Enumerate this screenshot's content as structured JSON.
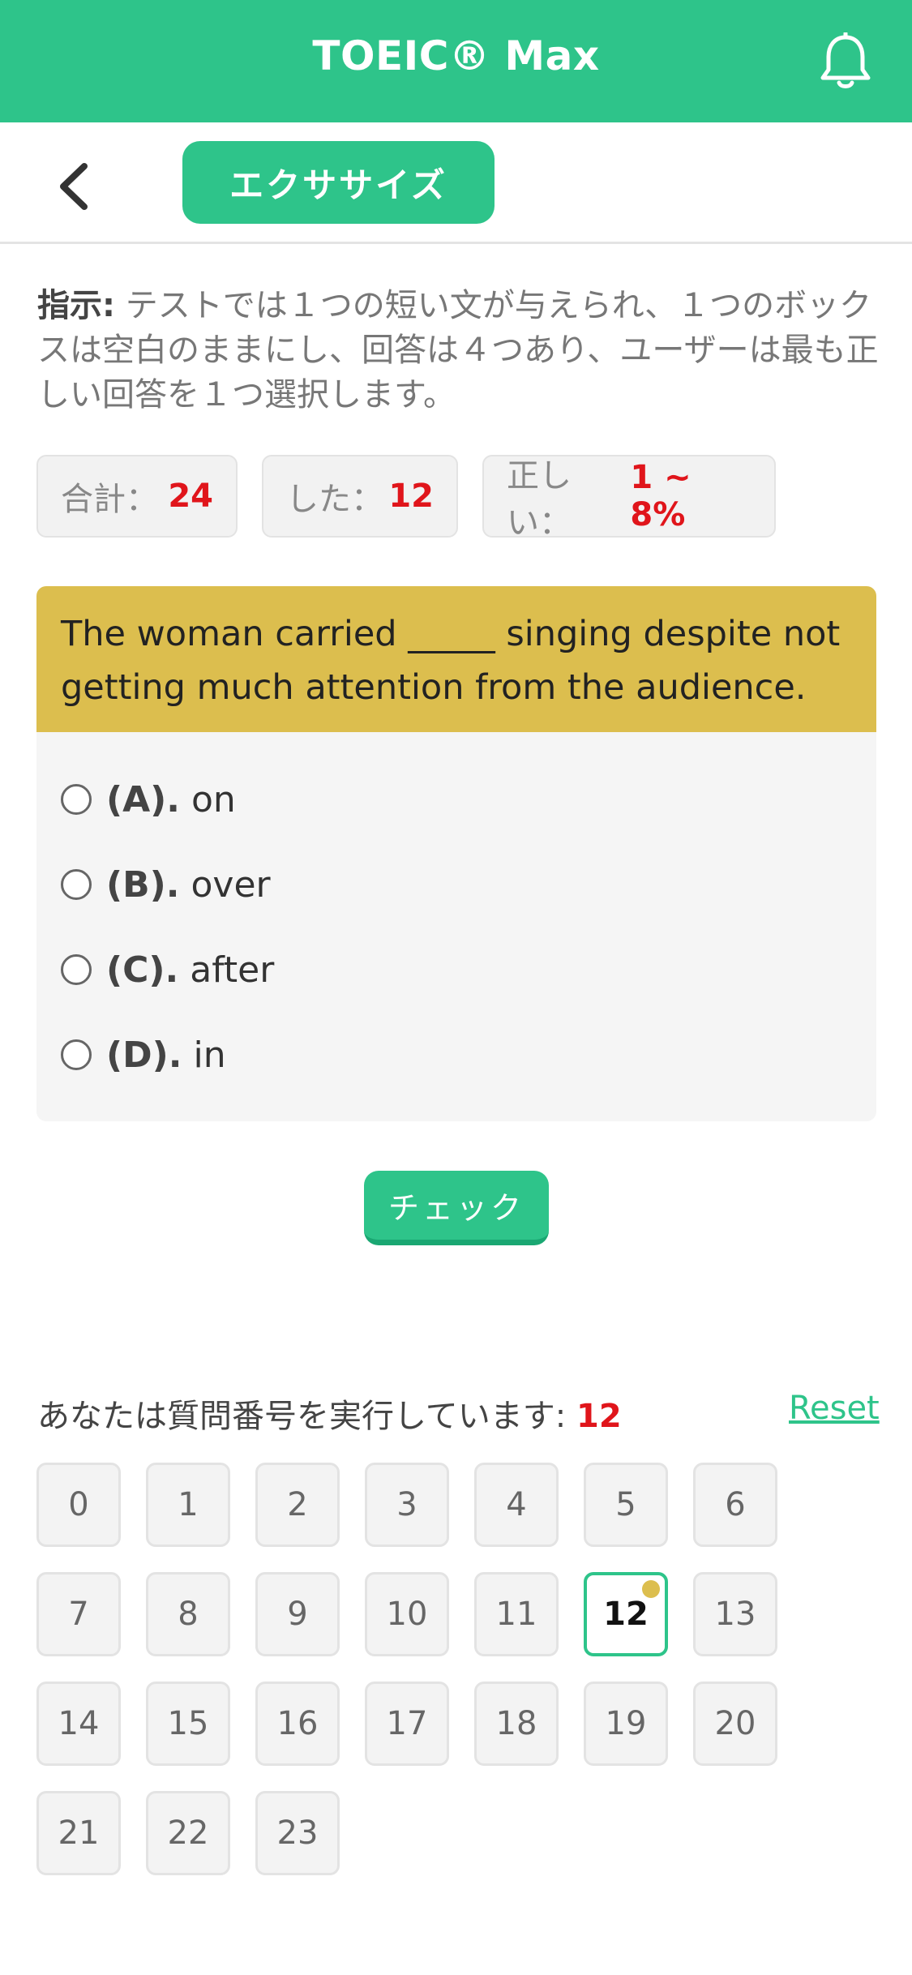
{
  "header": {
    "title": "TOEIC® Max",
    "bell_icon": "bell-icon"
  },
  "subheader": {
    "back_icon": "chevron-left-icon",
    "tab_label": "エクササイズ"
  },
  "instructions": {
    "label": "指示:",
    "text": " テストでは１つの短い文が与えられ、１つのボックスは空白のままにし、回答は４つあり、ユーザーは最も正しい回答を１つ選択します。"
  },
  "stats": {
    "total_label": "合計：",
    "total_value": "24",
    "done_label": "した：",
    "done_value": "12",
    "correct_label": "正しい：",
    "correct_value": "1 ~ 8%"
  },
  "question": {
    "text": "The woman carried _____ singing despite not getting much attention from the audience.",
    "options": [
      {
        "letter": "(A).",
        "text": "on"
      },
      {
        "letter": "(B).",
        "text": "over"
      },
      {
        "letter": "(C).",
        "text": "after"
      },
      {
        "letter": "(D).",
        "text": "in"
      }
    ]
  },
  "check_button": "チェック",
  "progress": {
    "label": "あなたは質問番号を実行しています:",
    "current": "12",
    "reset": "Reset"
  },
  "question_numbers": [
    "0",
    "1",
    "2",
    "3",
    "4",
    "5",
    "6",
    "7",
    "8",
    "9",
    "10",
    "11",
    "12",
    "13",
    "14",
    "15",
    "16",
    "17",
    "18",
    "19",
    "20",
    "21",
    "22",
    "23"
  ],
  "colors": {
    "brand": "#2ec48a",
    "question_band": "#dcbe4e",
    "highlight": "#e0151b"
  }
}
